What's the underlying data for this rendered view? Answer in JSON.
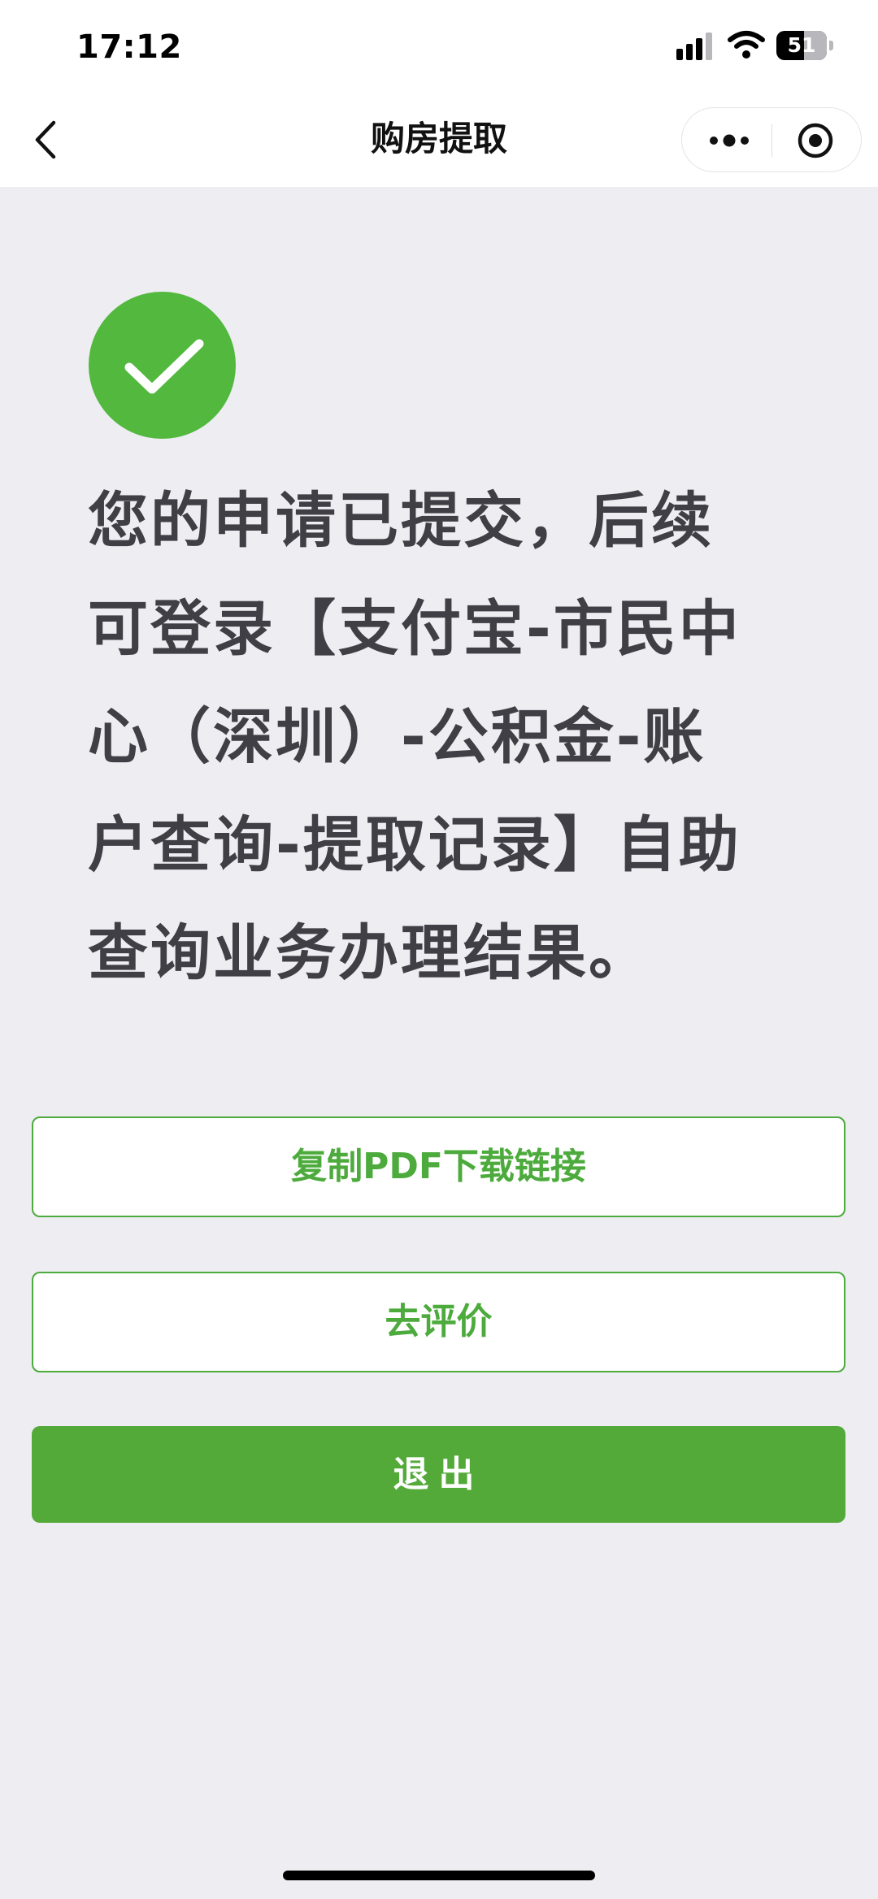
{
  "status_bar": {
    "time": "17:12",
    "battery_level": "51"
  },
  "nav": {
    "title": "购房提取",
    "icons": [
      "back-icon",
      "more-icon",
      "target-icon"
    ]
  },
  "result": {
    "icon": "checkmark-icon",
    "icon_color": "#52B83E",
    "message": "您的申请已提交，后续可登录【支付宝-市民中心（深圳）-公积金-账户查询-提取记录】自助查询业务办理结果。"
  },
  "actions": {
    "copy_pdf_link": "复制PDF下载链接",
    "rate": "去评价",
    "exit": "退出"
  },
  "colors": {
    "accent": "#4CAB3C",
    "primary_button": "#53AA39",
    "background": "#EDEDF2",
    "text": "#3F3F45"
  }
}
